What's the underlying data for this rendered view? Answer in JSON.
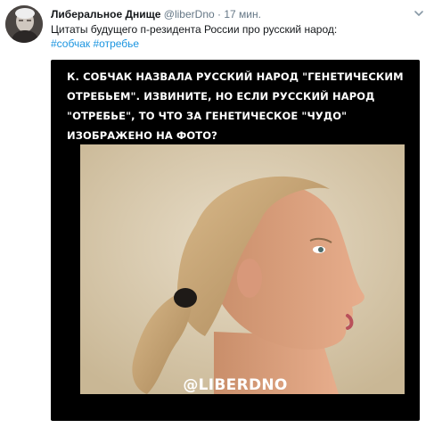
{
  "tweet": {
    "author": {
      "display_name": "Либеральное Днище",
      "handle": "@liberDno",
      "separator": "·",
      "time": "17 мин."
    },
    "text": "Цитаты будущего п-резидента России про русский народ:",
    "hashtags": [
      "#собчак",
      "#отребье"
    ],
    "media": {
      "caption": "К. СОБЧАК НАЗВАЛА РУССКИЙ НАРОД \"ГЕНЕТИЧЕСКИМ ОТРЕБЬЕМ\". ИЗВИНИТЕ, НО ЕСЛИ РУССКИЙ НАРОД \"ОТРЕБЬЕ\", ТО ЧТО ЗА ГЕНЕТИЧЕСКОЕ \"ЧУДО\" ИЗОБРАЖЕНО НА ФОТО?",
      "watermark": "@LIBERDNO"
    }
  },
  "colors": {
    "name": "#14171a",
    "muted": "#657786",
    "link": "#1b95e0",
    "media_bg": "#000000"
  },
  "icons": {
    "menu": "chevron-down-icon",
    "avatar": "avatar-photo"
  }
}
